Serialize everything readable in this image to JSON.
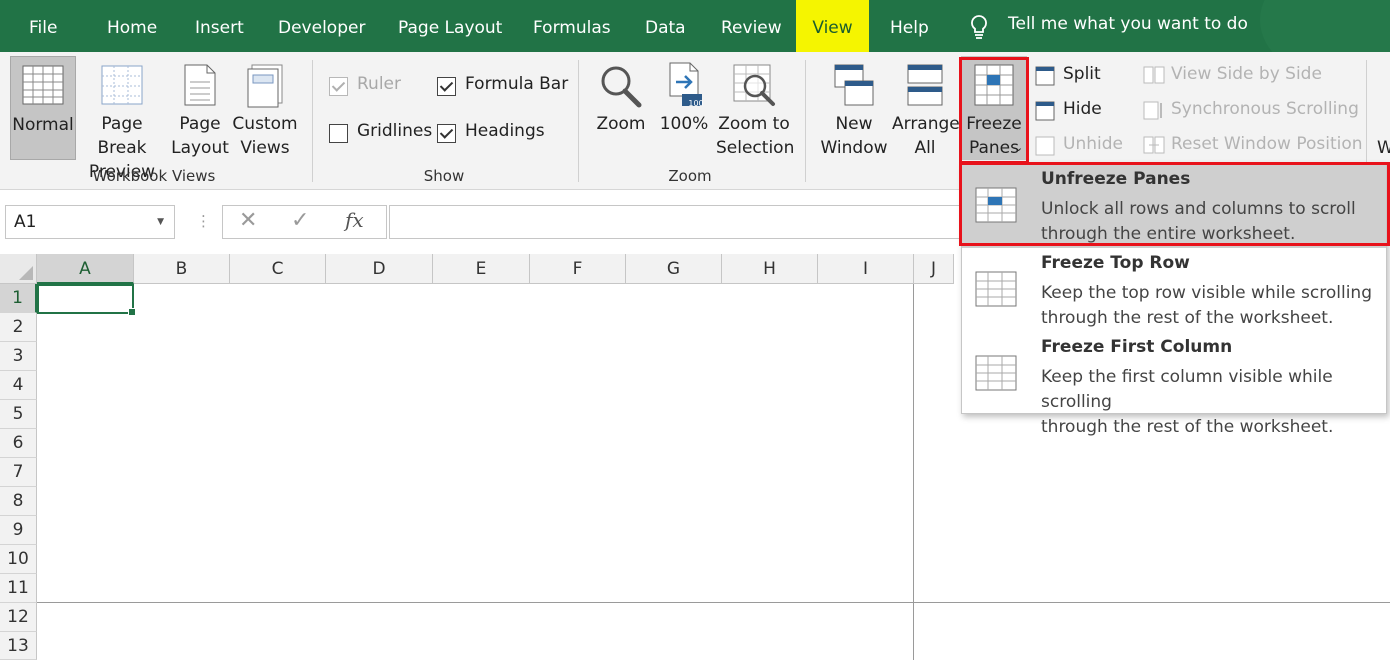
{
  "menu": {
    "tabs": [
      "File",
      "Home",
      "Insert",
      "Developer",
      "Page Layout",
      "Formulas",
      "Data",
      "Review",
      "View",
      "Help"
    ],
    "selected": "View",
    "tell_me": "Tell me what you want to do"
  },
  "ribbon": {
    "workbook_views": {
      "group_label": "Workbook Views",
      "normal": "Normal",
      "page_break": "Page Break\nPreview",
      "page_layout": "Page\nLayout",
      "custom_views": "Custom\nViews"
    },
    "show": {
      "group_label": "Show",
      "ruler": "Ruler",
      "formula_bar": "Formula Bar",
      "gridlines": "Gridlines",
      "headings": "Headings",
      "ruler_checked": true,
      "ruler_enabled": false,
      "formula_bar_checked": true,
      "gridlines_checked": false,
      "headings_checked": true
    },
    "zoom": {
      "group_label": "Zoom",
      "zoom": "Zoom",
      "hundred": "100%",
      "hundred_badge": "100",
      "zoom_selection": "Zoom to\nSelection"
    },
    "window": {
      "new_window": "New\nWindow",
      "arrange_all": "Arrange\nAll",
      "freeze_panes": "Freeze\nPanes",
      "split": "Split",
      "hide": "Hide",
      "unhide": "Unhide",
      "view_side": "View Side by Side",
      "sync_scroll": "Synchronous Scrolling",
      "reset_window": "Reset Window Position",
      "cut_letter": "W"
    }
  },
  "formula_bar": {
    "name_box": "A1",
    "fx": "fx",
    "cancel": "✕",
    "enter": "✓",
    "value": ""
  },
  "sheet": {
    "columns": [
      "A",
      "B",
      "C",
      "D",
      "E",
      "F",
      "G",
      "H",
      "I",
      "J"
    ],
    "rows": [
      "1",
      "2",
      "3",
      "4",
      "5",
      "6",
      "7",
      "8",
      "9",
      "10",
      "11",
      "12",
      "13"
    ],
    "active_cell": "A1"
  },
  "freeze_menu": {
    "items": [
      {
        "title": "Unfreeze Panes",
        "desc": "Unlock all rows and columns to scroll\nthrough the entire worksheet."
      },
      {
        "title": "Freeze Top Row",
        "desc": "Keep the top row visible while scrolling\nthrough the rest of the worksheet."
      },
      {
        "title": "Freeze First Column",
        "desc": "Keep the first column visible while scrolling\nthrough the rest of the worksheet."
      }
    ],
    "highlighted_index": 0
  },
  "colors": {
    "accent": "#217346",
    "highlight_tab": "#f5f500",
    "callout": "#e8121b"
  }
}
